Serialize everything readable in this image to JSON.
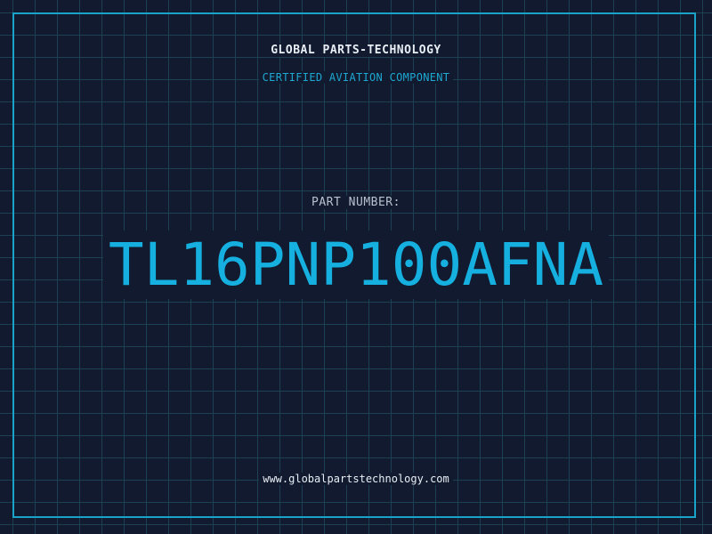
{
  "header": {
    "company_name": "GLOBAL PARTS-TECHNOLOGY",
    "tagline": "CERTIFIED AVIATION COMPONENT"
  },
  "part": {
    "label": "PART NUMBER:",
    "number": "TL16PNP100AFNA"
  },
  "footer": {
    "website": "www.globalpartstechnology.com"
  },
  "colors": {
    "background": "#111a2e",
    "grid": "#1c4152",
    "accent": "#15b0e0",
    "frame": "#1aa3c8",
    "text": "#e8eef5"
  }
}
